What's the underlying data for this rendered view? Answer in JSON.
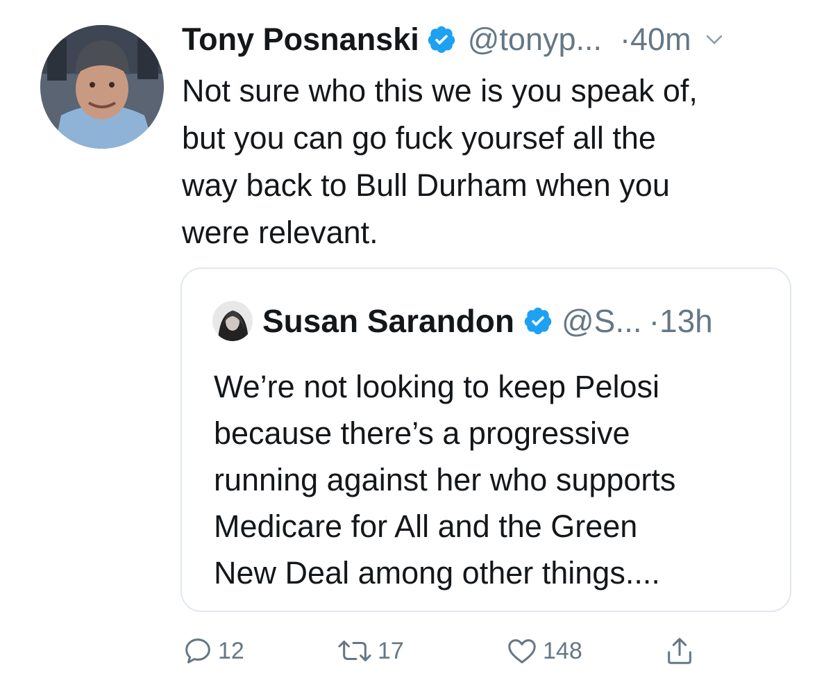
{
  "tweet": {
    "author_name": "Tony Posnanski",
    "author_handle": "@tonyp...",
    "time": "·40m",
    "text_lines": [
      "Not sure who this we is you speak of,",
      "but you can go fuck yoursef all the",
      "way back to Bull Durham when you",
      "were relevant."
    ],
    "icons": {
      "verified": "verified-badge-icon",
      "menu": "chevron-down-icon",
      "avatar": "avatar"
    }
  },
  "quoted_tweet": {
    "author_name": "Susan Sarandon",
    "author_handle": "@S...",
    "time": "·13h",
    "text_lines": [
      "We’re not looking to keep Pelosi",
      "because there’s a progressive",
      "running against her who supports",
      "Medicare for All and the Green",
      "New Deal among other things...."
    ]
  },
  "actions": {
    "reply_count": "12",
    "retweet_count": "17",
    "like_count": "148"
  },
  "colors": {
    "text": "#14171a",
    "secondary": "#657786",
    "verified": "#1da1f2",
    "border": "#e1e8ed"
  }
}
